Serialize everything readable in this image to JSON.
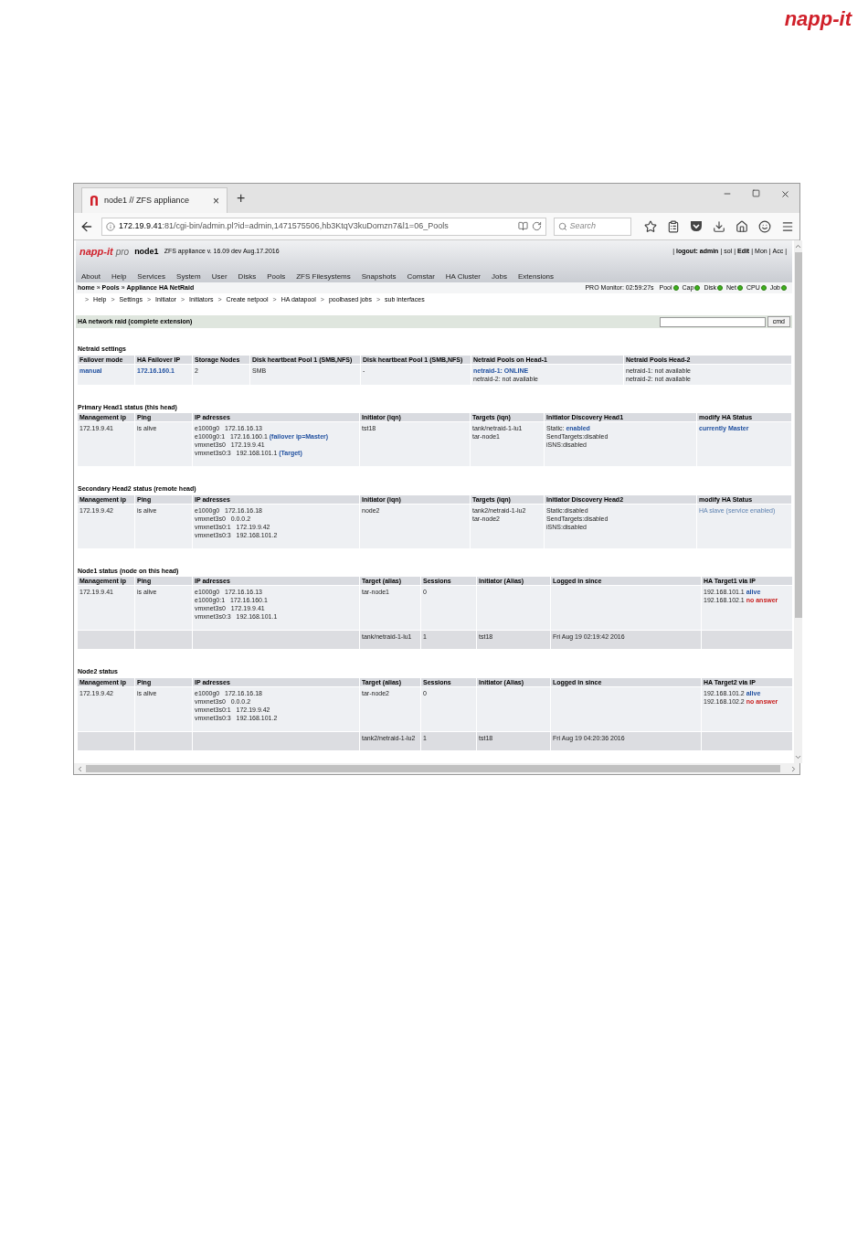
{
  "logo": "napp-it",
  "browser": {
    "tab_title": "node1 // ZFS appliance",
    "tab_close": "×",
    "new_tab": "+",
    "url_host": "172.19.9.41",
    "url_rest": ":81/cgi-bin/admin.pl?id=admin,1471575506,hb3KtqV3kuDomzn7&l1=06_Pools",
    "search_placeholder": "Search"
  },
  "app": {
    "brand": "napp-it",
    "brand_suffix": "pro",
    "host": "node1",
    "version": "ZFS appliance v. 16.09 dev Aug.17.2016",
    "user_links": [
      {
        "label": "logout: admin",
        "bold": true
      },
      {
        "label": "sol",
        "bold": false
      },
      {
        "label": "Edit",
        "bold": true
      },
      {
        "label": "Mon",
        "bold": false
      },
      {
        "label": "Acc",
        "bold": false
      }
    ],
    "menu": [
      "About",
      "Help",
      "Services",
      "System",
      "User",
      "Disks",
      "Pools",
      "ZFS Filesystems",
      "Snapshots",
      "Comstar",
      "HA Cluster",
      "Jobs",
      "Extensions"
    ],
    "breadcrumb": [
      "home",
      "Pools",
      "Appliance HA NetRaid"
    ],
    "monitor_label": "PRO Monitor: 02:59:27s",
    "monitor": [
      "Pool",
      "Cap",
      "Disk",
      "Net",
      "CPU",
      "Job"
    ],
    "submenu": [
      "Help",
      "Settings",
      "Initiator",
      "Initiators",
      "Create netpool",
      "HA datapool",
      "poolbased jobs",
      "sub interfaces"
    ],
    "page_title": "HA network raid (complete extension)",
    "cmd_button": "cmd",
    "link_separator": "|",
    "breadcrumb_separator": "»",
    "submenu_marker": ">"
  },
  "sections": [
    {
      "kind": "settings",
      "title": "Netraid settings",
      "columns": [
        "Failover mode",
        "HA Failover IP",
        "Storage Nodes",
        "Disk heartbeat Pool 1 (SMB,NFS)",
        "Disk heartbeat Pool 1 (SMB,NFS)",
        "Netraid Pools on Head-1",
        "Netraid Pools Head-2"
      ],
      "rows": [
        {
          "kind": "main",
          "cells": [
            [
              {
                "text": "manual",
                "kind": "link"
              }
            ],
            [
              {
                "text": "172.16.160.1",
                "kind": "link"
              }
            ],
            [
              {
                "text": "2"
              }
            ],
            [
              {
                "text": "SMB"
              }
            ],
            [
              {
                "text": "-"
              }
            ],
            [
              {
                "text": "netraid-1: ONLINE",
                "kind": "link"
              },
              {
                "text": "netraid-2: not available"
              }
            ],
            [
              {
                "text": "netraid-1: not available"
              },
              {
                "text": "netraid-2: not available"
              }
            ]
          ]
        }
      ]
    },
    {
      "kind": "head",
      "title": "Primary Head1 status (this head)",
      "columns": [
        "Management ip",
        "Ping",
        "IP adresses",
        "Initiator (iqn)",
        "Targets (iqn)",
        "Initiator Discovery Head1",
        "modify HA Status"
      ],
      "rows": [
        {
          "kind": "main",
          "cells": [
            [
              {
                "text": "172.19.9.41"
              }
            ],
            [
              {
                "text": "is alive"
              }
            ],
            [
              {
                "text": "e1000g0   172.16.16.13"
              },
              {
                "text": "e1000g0:1   172.16.160.1",
                "tag": {
                  "text": "(failover ip=Master)",
                  "kind": "link"
                }
              },
              {
                "text": "vmxnet3s0   172.19.9.41"
              },
              {
                "text": "vmxnet3s0:3   192.168.101.1",
                "tag": {
                  "text": "(Target)",
                  "kind": "link"
                }
              }
            ],
            [
              {
                "text": "tst18"
              }
            ],
            [
              {
                "text": "tank/netraid-1-lu1"
              },
              {
                "text": "tar-node1"
              }
            ],
            [
              {
                "text": "Static:",
                "tag": {
                  "text": "enabled",
                  "kind": "link"
                }
              },
              {
                "text": "SendTargets:disabled"
              },
              {
                "text": "iSNS:disabled"
              }
            ],
            [
              {
                "text": "currently Master",
                "kind": "link"
              }
            ]
          ]
        }
      ]
    },
    {
      "kind": "head",
      "title": "Secondary Head2 status (remote head)",
      "columns": [
        "Management ip",
        "Ping",
        "IP adresses",
        "Initiator (iqn)",
        "Targets (iqn)",
        "Initiator Discovery Head2",
        "modify HA Status"
      ],
      "rows": [
        {
          "kind": "main",
          "cells": [
            [
              {
                "text": "172.19.9.42"
              }
            ],
            [
              {
                "text": "is alive"
              }
            ],
            [
              {
                "text": "e1000g0   172.16.16.18"
              },
              {
                "text": "vmxnet3s0   0.0.0.2"
              },
              {
                "text": "vmxnet3s0:1   172.19.9.42"
              },
              {
                "text": "vmxnet3s0:3   192.168.101.2"
              }
            ],
            [
              {
                "text": "node2"
              }
            ],
            [
              {
                "text": "tank2/netraid-1-lu2"
              },
              {
                "text": "tar-node2"
              }
            ],
            [
              {
                "text": "Static:disabled"
              },
              {
                "text": "SendTargets:disabled"
              },
              {
                "text": "iSNS:disabled"
              }
            ],
            [
              {
                "text": "HA slave (service enabled)",
                "kind": "muted-link"
              }
            ]
          ]
        }
      ]
    },
    {
      "kind": "node",
      "title": "Node1 status (node on this head)",
      "columns": [
        "Management ip",
        "Ping",
        "IP adresses",
        "Target (alias)",
        "Sessions",
        "Initiator (Alias)",
        "Logged in since",
        "HA Target1 via IP"
      ],
      "rows": [
        {
          "kind": "main",
          "cells": [
            [
              {
                "text": "172.19.9.41"
              }
            ],
            [
              {
                "text": "is alive"
              }
            ],
            [
              {
                "text": "e1000g0   172.16.16.13"
              },
              {
                "text": "e1000g0:1   172.16.160.1"
              },
              {
                "text": "vmxnet3s0   172.19.9.41"
              },
              {
                "text": "vmxnet3s0:3   192.168.101.1"
              }
            ],
            [
              {
                "text": "tar-node1"
              }
            ],
            [
              {
                "text": "0"
              }
            ],
            null,
            null,
            [
              {
                "text": "192.168.101.1",
                "tag": {
                  "text": "alive",
                  "kind": "link"
                }
              },
              {
                "text": "192.168.102.1",
                "tag": {
                  "text": "no answer",
                  "kind": "alert"
                }
              }
            ]
          ]
        },
        {
          "kind": "session",
          "cells": [
            null,
            null,
            null,
            [
              {
                "text": "tank/netraid-1-lu1"
              }
            ],
            [
              {
                "text": "1"
              }
            ],
            [
              {
                "text": "tst18"
              }
            ],
            [
              {
                "text": "Fri Aug 19 02:19:42 2016"
              }
            ],
            null
          ]
        }
      ]
    },
    {
      "kind": "node",
      "title": "Node2 status",
      "columns": [
        "Management ip",
        "Ping",
        "IP adresses",
        "Target (alias)",
        "Sessions",
        "Initiator (Alias)",
        "Logged in since",
        "HA Target2 via IP"
      ],
      "rows": [
        {
          "kind": "main",
          "cells": [
            [
              {
                "text": "172.19.9.42"
              }
            ],
            [
              {
                "text": "is alive"
              }
            ],
            [
              {
                "text": "e1000g0   172.16.16.18"
              },
              {
                "text": "vmxnet3s0   0.0.0.2"
              },
              {
                "text": "vmxnet3s0:1   172.19.9.42"
              },
              {
                "text": "vmxnet3s0:3   192.168.101.2"
              }
            ],
            [
              {
                "text": "tar-node2"
              }
            ],
            [
              {
                "text": "0"
              }
            ],
            null,
            null,
            [
              {
                "text": "192.168.101.2",
                "tag": {
                  "text": "alive",
                  "kind": "link"
                }
              },
              {
                "text": "192.168.102.2",
                "tag": {
                  "text": "no answer",
                  "kind": "alert"
                }
              }
            ]
          ]
        },
        {
          "kind": "session",
          "cells": [
            null,
            null,
            null,
            [
              {
                "text": "tank2/netraid-1-lu2"
              }
            ],
            [
              {
                "text": "1"
              }
            ],
            [
              {
                "text": "tst18"
              }
            ],
            [
              {
                "text": "Fri Aug 19 04:20:36 2016"
              }
            ],
            null
          ]
        }
      ]
    }
  ]
}
